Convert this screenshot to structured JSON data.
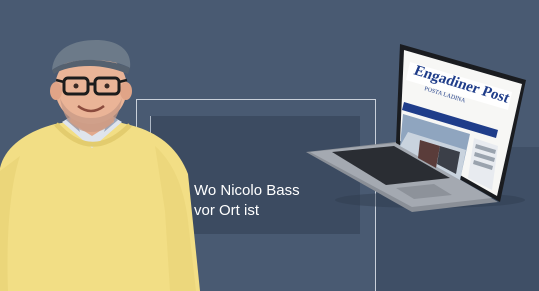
{
  "banner": {
    "tagline_line1": "Wo Nicolo Bass",
    "tagline_line2": "vor Ort ist"
  },
  "laptop_screen": {
    "masthead": "Engadiner Post",
    "subtitle": "POSTA LADINA"
  },
  "colors": {
    "background": "#495a72",
    "panel": "#3c4b61",
    "text": "#ffffff",
    "sweater": "#f3df86",
    "masthead_blue": "#1f3d8a"
  },
  "icons": [
    "person-photo",
    "laptop-image"
  ]
}
